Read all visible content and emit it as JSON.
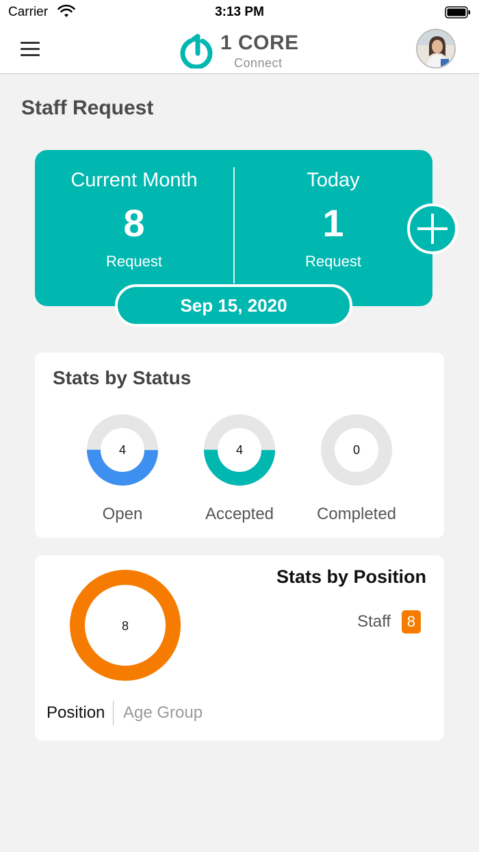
{
  "status_bar": {
    "carrier": "Carrier",
    "time": "3:13 PM"
  },
  "app_bar": {
    "logo_title": "1 CORE",
    "logo_subtitle": "Connect"
  },
  "page": {
    "title": "Staff Request"
  },
  "summary": {
    "current_month": {
      "label": "Current Month",
      "count": "8",
      "sublabel": "Request"
    },
    "today": {
      "label": "Today",
      "count": "1",
      "sublabel": "Request"
    },
    "date": "Sep 15, 2020"
  },
  "stats_by_status": {
    "title": "Stats by Status",
    "items": [
      {
        "label": "Open",
        "value": "4",
        "color": "#3d8ff0"
      },
      {
        "label": "Accepted",
        "value": "4",
        "color": "#00b8b0"
      },
      {
        "label": "Completed",
        "value": "0",
        "color": "#e6e6e6"
      }
    ]
  },
  "stats_by_position": {
    "title": "Stats by Position",
    "total": "8",
    "legend": [
      {
        "label": "Staff",
        "value": "8",
        "color": "#f57c00"
      }
    ],
    "tabs": [
      "Position",
      "Age Group"
    ]
  },
  "colors": {
    "accent": "#00b8b0",
    "open": "#3d8ff0",
    "staff": "#f57c00",
    "track": "#e6e6e6"
  }
}
